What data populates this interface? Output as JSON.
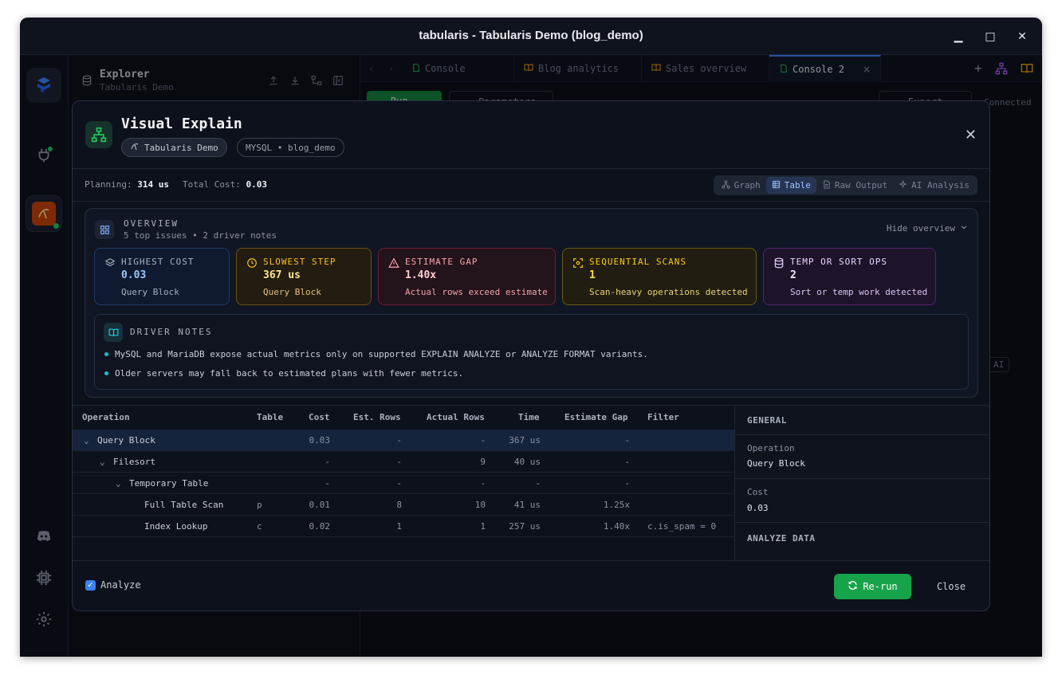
{
  "window": {
    "title": "tabularis - Tabularis Demo (blog_demo)",
    "minimize": "▁",
    "maximize": "□",
    "close": "✕"
  },
  "explorer": {
    "title": "Explorer",
    "subtitle": "Tabularis Demo"
  },
  "tabs": [
    {
      "label": "Console",
      "icon": "file-icon"
    },
    {
      "label": "Blog analytics",
      "icon": "book-icon"
    },
    {
      "label": "Sales overview",
      "icon": "book-icon"
    },
    {
      "label": "Console 2",
      "icon": "file-icon",
      "active": true
    }
  ],
  "background": {
    "run_label": "Run",
    "params_label": "Parameters",
    "export_label": "Export",
    "status": "Connected",
    "ai_label": "AI"
  },
  "modal": {
    "title": "Visual Explain",
    "connection": "Tabularis Demo",
    "database": "MYSQL • blog_demo",
    "planning_label": "Planning:",
    "planning_value": "314 us",
    "cost_label": "Total Cost:",
    "cost_value": "0.03",
    "view_tabs": [
      {
        "label": "Graph",
        "icon": "graph-icon"
      },
      {
        "label": "Table",
        "icon": "table-icon",
        "active": true
      },
      {
        "label": "Raw Output",
        "icon": "document-icon"
      },
      {
        "label": "AI Analysis",
        "icon": "sparkle-icon"
      }
    ]
  },
  "overview": {
    "title": "OVERVIEW",
    "subtitle": "5 top issues • 2 driver notes",
    "hide_label": "Hide overview",
    "cards": [
      {
        "label": "HIGHEST COST",
        "value": "0.03",
        "sub": "Query Block",
        "color": "#3b82f6"
      },
      {
        "label": "SLOWEST STEP",
        "value": "367 us",
        "sub": "Query Block",
        "color": "#f59e0b"
      },
      {
        "label": "ESTIMATE GAP",
        "value": "1.40x",
        "sub": "Actual rows exceed estimate",
        "color": "#f43f5e"
      },
      {
        "label": "SEQUENTIAL SCANS",
        "value": "1",
        "sub": "Scan-heavy operations detected",
        "color": "#eab308"
      },
      {
        "label": "TEMP OR SORT OPS",
        "value": "2",
        "sub": "Sort or temp work detected",
        "color": "#a855f7"
      }
    ],
    "notes_title": "DRIVER NOTES",
    "notes": [
      "MySQL and MariaDB expose actual metrics only on supported EXPLAIN ANALYZE or ANALYZE FORMAT variants.",
      "Older servers may fall back to estimated plans with fewer metrics."
    ]
  },
  "grid": {
    "headers": [
      "Operation",
      "Table",
      "Cost",
      "Est. Rows",
      "Actual Rows",
      "Time",
      "Estimate Gap",
      "Filter"
    ],
    "rows": [
      {
        "op": "Query Block",
        "table": "",
        "cost": "0.03",
        "est": "-",
        "actual": "-",
        "time": "367 us",
        "gap": "-",
        "filter": ""
      },
      {
        "op": "Filesort",
        "table": "",
        "cost": "-",
        "est": "-",
        "actual": "9",
        "time": "40 us",
        "gap": "-",
        "filter": ""
      },
      {
        "op": "Temporary Table",
        "table": "",
        "cost": "-",
        "est": "-",
        "actual": "-",
        "time": "-",
        "gap": "-",
        "filter": ""
      },
      {
        "op": "Full Table Scan",
        "table": "p",
        "cost": "0.01",
        "est": "8",
        "actual": "10",
        "time": "41 us",
        "gap": "1.25x",
        "filter": ""
      },
      {
        "op": "Index Lookup",
        "table": "c",
        "cost": "0.02",
        "est": "1",
        "actual": "1",
        "time": "257 us",
        "gap": "1.40x",
        "filter": "c.is_spam = 0"
      }
    ]
  },
  "detail": {
    "general": "GENERAL",
    "op_label": "Operation",
    "op_value": "Query Block",
    "cost_label": "Cost",
    "cost_value": "0.03",
    "analyze": "ANALYZE DATA"
  },
  "footer": {
    "analyze_label": "Analyze",
    "rerun_label": "Re-run",
    "close_label": "Close"
  }
}
